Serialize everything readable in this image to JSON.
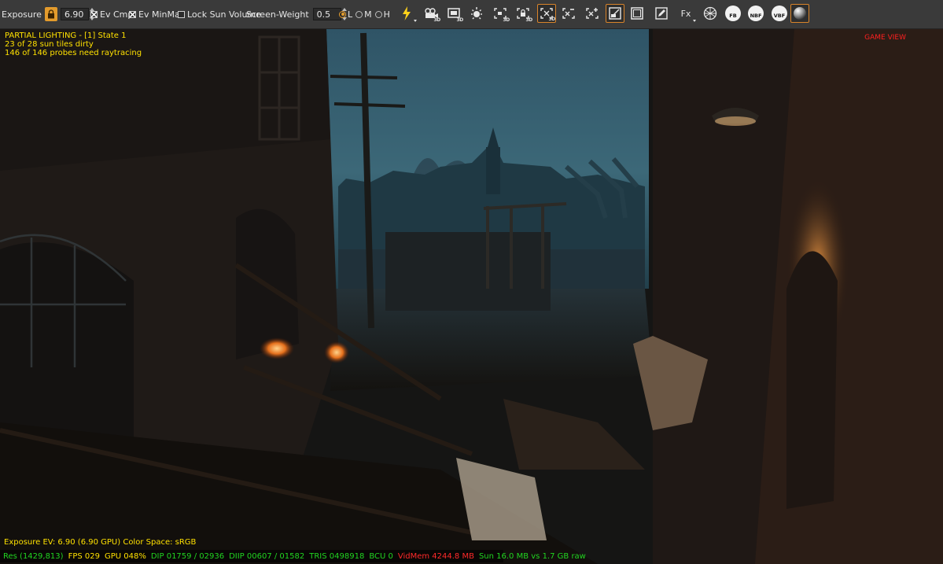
{
  "toolbar": {
    "exposure_label": "Exposure",
    "exposure_value": "6.90",
    "ev_cmp_label": "Ev Cmp",
    "ev_minmax_label": "Ev MinMax",
    "lock_sun_volume_label": "Lock Sun Volume",
    "screen_weight_label": "Screen-Weight",
    "screen_weight_value": "0.5",
    "quality_l": "L",
    "quality_m": "M",
    "quality_h": "H",
    "btn_3d": "3D",
    "fx_label": "Fx",
    "fb_label": "FB",
    "nbf_label": "NBF",
    "vbf_label": "VBF",
    "icons": [
      "lock-icon",
      "lightning-icon",
      "camera-3d-icon",
      "screenshot-3d-icon",
      "sun-icon",
      "probe-3d-icon",
      "lock-3d-icon",
      "grid-x-3d-icon",
      "grid-minus-icon",
      "grid-plus-icon",
      "render-view-icon",
      "frame-icon",
      "pencil-icon",
      "fx-icon",
      "wireframe-icon",
      "fb-icon",
      "nbf-icon",
      "vbf-icon",
      "sphere-icon"
    ],
    "accent_color": "#e39b2c"
  },
  "overlay": {
    "lighting_title": "PARTIAL LIGHTING - [1] State 1",
    "sun_tiles": "23 of 28 sun tiles dirty",
    "probes": "146 of 146 probes need raytracing",
    "view_label": "GAME VIEW",
    "exposure_info": "Exposure EV: 6.90 (6.90 GPU)  Color Space: sRGB",
    "text_color": "#ffe100",
    "view_label_color": "#ff2020"
  },
  "status": {
    "res": "Res (1429,813)",
    "fps": "FPS 029",
    "gpu": "GPU 048%",
    "dip": "DIP 01759 / 02936",
    "diip": "DIIP 00607 / 01582",
    "tris": "TRIS 0498918",
    "bcu": "BCU 0",
    "vidmem": "VidMem 4244.8 MB",
    "sun": "Sun 16.0 MB vs 1.7 GB raw",
    "green_color": "#21d421",
    "red_color": "#ff2a2a"
  }
}
